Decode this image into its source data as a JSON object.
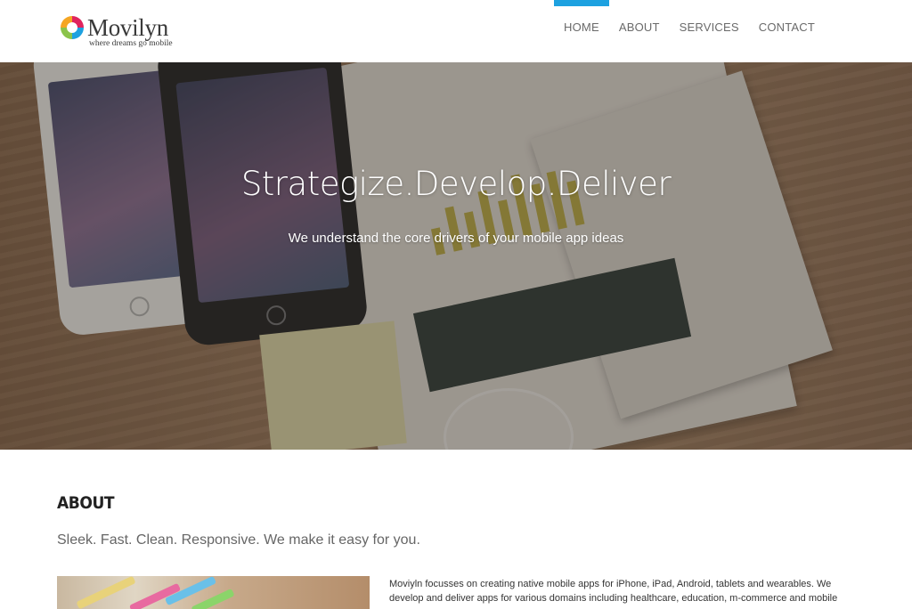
{
  "brand": {
    "name": "Movilyn",
    "tagline": "where dreams go mobile",
    "logo_colors": [
      "#e0245e",
      "#1da1e0",
      "#8bc34a",
      "#f5a623"
    ]
  },
  "nav": {
    "items": [
      {
        "label": "HOME",
        "active": true
      },
      {
        "label": "ABOUT",
        "active": false
      },
      {
        "label": "SERVICES",
        "active": false
      },
      {
        "label": "CONTACT",
        "active": false
      }
    ],
    "accent_color": "#1da1e0"
  },
  "hero": {
    "title": "Strategize.Develop.Deliver",
    "subtitle": "We understand the core drivers of your mobile app ideas"
  },
  "about": {
    "heading": "ABOUT",
    "tagline": "Sleek. Fast. Clean. Responsive. We make it easy for you.",
    "body": "Moviyln focusses on creating native mobile apps for iPhone, iPad, Android, tablets and wearables. We develop and deliver apps for various domains including healthcare, education, m-commerce and mobile games."
  }
}
